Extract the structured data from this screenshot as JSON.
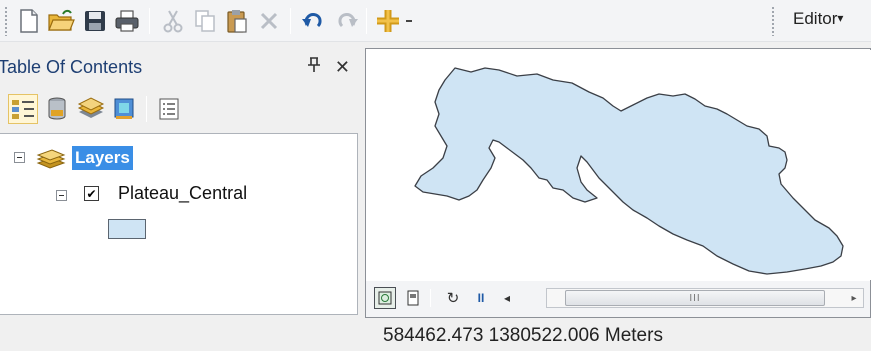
{
  "toolbar": {
    "buttons": [
      {
        "name": "new-document-button",
        "icon": "new-document-icon"
      },
      {
        "name": "open-button",
        "icon": "folder-open-icon"
      },
      {
        "name": "save-button",
        "icon": "save-icon"
      },
      {
        "name": "print-button",
        "icon": "print-icon"
      },
      {
        "name": "cut-button",
        "icon": "scissors-icon"
      },
      {
        "name": "copy-button",
        "icon": "copy-icon"
      },
      {
        "name": "paste-button",
        "icon": "paste-icon"
      },
      {
        "name": "delete-button",
        "icon": "delete-icon"
      },
      {
        "name": "undo-button",
        "icon": "undo-icon"
      },
      {
        "name": "redo-button",
        "icon": "redo-icon"
      },
      {
        "name": "add-data-button",
        "icon": "add-data-icon"
      }
    ],
    "editor_label": "Editor",
    "editor_arrow": "▾"
  },
  "toc": {
    "title": "Table Of Contents",
    "pin_glyph": "ᵖ",
    "close_glyph": "✕",
    "tools": [
      {
        "name": "list-by-drawing-order-button",
        "icon": "drawing-order-icon"
      },
      {
        "name": "list-by-source-button",
        "icon": "database-icon"
      },
      {
        "name": "list-by-visibility-button",
        "icon": "layer-stack-icon"
      },
      {
        "name": "list-by-selection-button",
        "icon": "selection-icon"
      },
      {
        "name": "toc-options-button",
        "icon": "options-icon"
      }
    ],
    "group_label": "Layers",
    "layer_name": "Plateau_Central",
    "layer_checked": "✔",
    "legend_fill": "#cfe4f4"
  },
  "map": {
    "polygon_fill": "#cfe4f4",
    "polygon_stroke": "#3b3f46",
    "scroll_grip": "III",
    "scroll_left": "◂",
    "scroll_right": "▸",
    "pause_glyph": "II",
    "refresh_glyph": "↻"
  },
  "status": {
    "coordinates": "584462.473  1380522.006 Meters"
  }
}
